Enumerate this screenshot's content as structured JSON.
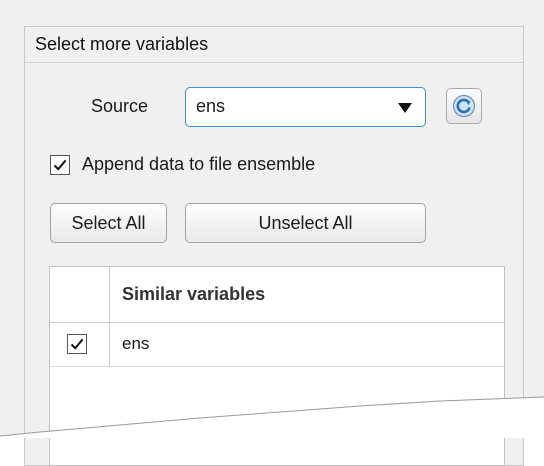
{
  "panel": {
    "title": "Select more variables"
  },
  "source": {
    "label": "Source",
    "selected": "ens",
    "refresh_icon": "refresh-icon"
  },
  "append": {
    "label": "Append data to file ensemble",
    "checked": true
  },
  "buttons": {
    "select_all": "Select All",
    "unselect_all": "Unselect All"
  },
  "table": {
    "header": "Similar variables",
    "rows": [
      {
        "label": "ens",
        "checked": true
      }
    ]
  },
  "colors": {
    "accent": "#3b8fd6",
    "panel_bg": "#f0f0f0",
    "border": "#c8c8c8"
  }
}
